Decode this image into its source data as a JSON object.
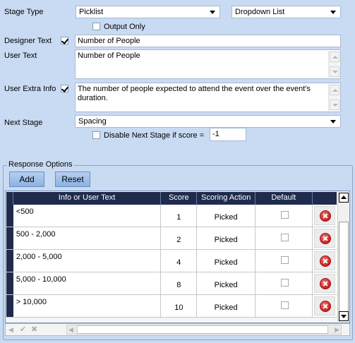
{
  "fields": {
    "stage_type_label": "Stage Type",
    "stage_type_value": "Picklist",
    "display_type_value": "Dropdown List",
    "output_only_label": "Output Only",
    "output_only_checked": false,
    "designer_text_label": "Designer Text",
    "designer_text_checked": true,
    "designer_text_value": "Number of People",
    "user_text_label": "User Text",
    "user_text_value": "Number of People",
    "user_extra_info_label": "User Extra Info",
    "user_extra_info_checked": true,
    "user_extra_info_value": "The number of people expected to attend the event over the event's duration.",
    "next_stage_label": "Next Stage",
    "next_stage_value": "Spacing",
    "disable_next_stage_label": "Disable Next Stage if score =",
    "disable_next_stage_checked": false,
    "disable_next_stage_value": "-1"
  },
  "response_options": {
    "title": "Response Options",
    "add_label": "Add",
    "reset_label": "Reset",
    "columns": [
      "Info or User Text",
      "Score",
      "Scoring Action",
      "Default"
    ],
    "rows": [
      {
        "text": "<500",
        "score": "1",
        "action": "Picked",
        "default": false
      },
      {
        "text": "500 - 2,000",
        "score": "2",
        "action": "Picked",
        "default": false
      },
      {
        "text": "2,000 - 5,000",
        "score": "4",
        "action": "Picked",
        "default": false
      },
      {
        "text": "5,000 - 10,000",
        "score": "8",
        "action": "Picked",
        "default": false
      },
      {
        "text": "> 10,000",
        "score": "10",
        "action": "Picked",
        "default": false
      }
    ],
    "nav_icons": [
      "left-arrow-icon",
      "check-icon",
      "cancel-icon"
    ]
  },
  "colors": {
    "background": "#c9dbf2",
    "header": "#1e2b4d",
    "button": "#9dbde8",
    "delete": "#c81f1f"
  }
}
